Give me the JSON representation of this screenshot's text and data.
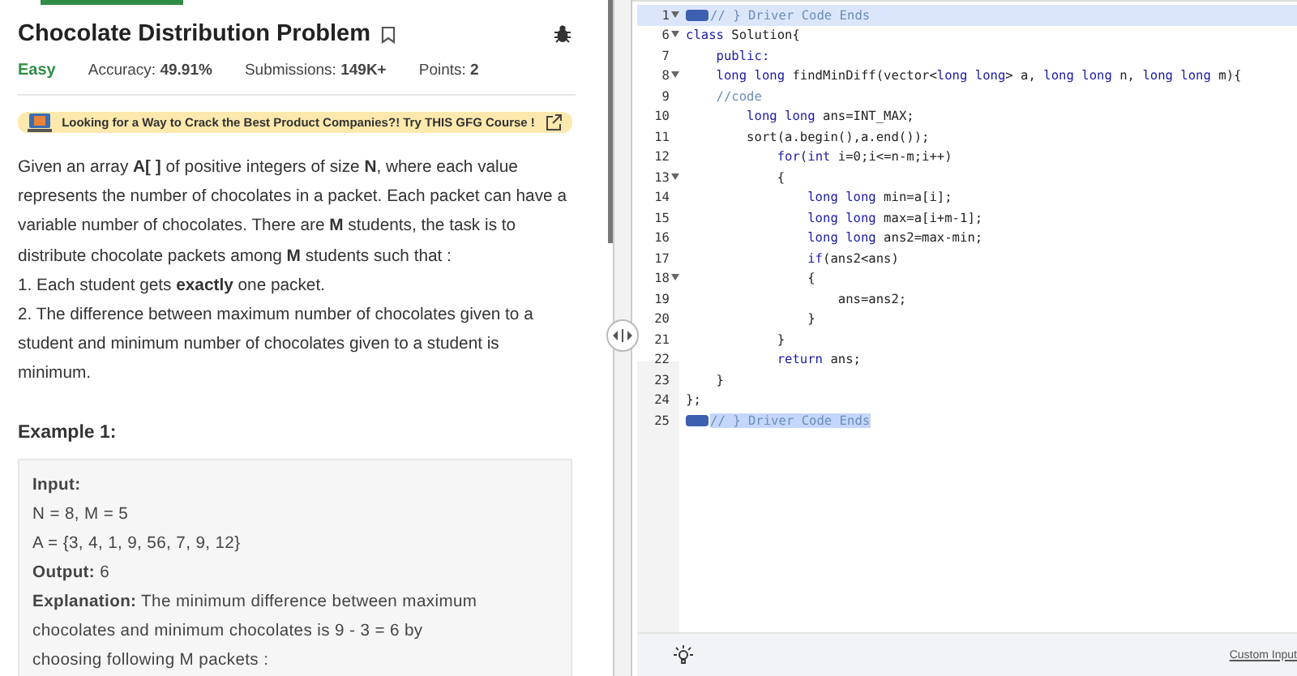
{
  "top_tab": {
    "selected": true
  },
  "problem": {
    "title": "Chocolate Distribution Problem",
    "difficulty": "Easy",
    "stats": [
      {
        "label": "Accuracy:",
        "value": "49.91%"
      },
      {
        "label": "Submissions:",
        "value": "149K+"
      },
      {
        "label": "Points:",
        "value": "2"
      }
    ],
    "banner": "Looking for a Way to Crack the Best Product Companies?! Try THIS GFG Course !",
    "description": [
      "Given an array **A[ ]** of positive integers of size **N**, where each value represents the number of chocolates in a packet. Each packet can have a variable number of chocolates. There are **M** students, the task is to distribute chocolate packets among **M** students such that :",
      "1. Each student gets **exactly** one packet.",
      "2. The difference between maximum number of chocolates given to a student and minimum number of chocolates given to a student is minimum."
    ],
    "example_title": "Example 1:",
    "example_lines": [
      {
        "kind": "label",
        "text": "Input:"
      },
      {
        "kind": "text",
        "text": "N = 8, M = 5"
      },
      {
        "kind": "text",
        "text": "A = {3, 4, 1, 9, 56, 7, 9, 12}"
      },
      {
        "kind": "text",
        "text": "**Output:** 6"
      },
      {
        "kind": "text",
        "text": "**Explanation:** The minimum difference between maximum chocolates and minimum chocolates is 9 - 3 = 6 by choosing following M packets :"
      }
    ]
  },
  "editor": {
    "lines": [
      {
        "number": "1",
        "foldable": true,
        "highlighted": true,
        "folded": true,
        "tokens": [
          {
            "kind": "comment",
            "text": "// } Driver Code Ends"
          }
        ]
      },
      {
        "number": "6",
        "foldable": true,
        "highlighted": false,
        "folded": false,
        "tokens": [
          {
            "kind": "keyword",
            "text": "class"
          },
          {
            "kind": "plain",
            "text": " Solution{"
          }
        ]
      },
      {
        "number": "7",
        "foldable": false,
        "highlighted": false,
        "folded": false,
        "tokens": [
          {
            "kind": "keyword",
            "text": "    public:"
          }
        ]
      },
      {
        "number": "8",
        "foldable": true,
        "highlighted": false,
        "folded": false,
        "tokens": [
          {
            "kind": "keyword",
            "text": "    long long"
          },
          {
            "kind": "plain",
            "text": " findMinDiff(vector<"
          },
          {
            "kind": "keyword",
            "text": "long long"
          },
          {
            "kind": "plain",
            "text": "> a, "
          },
          {
            "kind": "keyword",
            "text": "long long"
          },
          {
            "kind": "plain",
            "text": " n, "
          },
          {
            "kind": "keyword",
            "text": "long long"
          },
          {
            "kind": "plain",
            "text": " m){"
          }
        ]
      },
      {
        "number": "9",
        "foldable": false,
        "highlighted": false,
        "folded": false,
        "tokens": [
          {
            "kind": "comment",
            "text": "    //code"
          }
        ]
      },
      {
        "number": "10",
        "foldable": false,
        "highlighted": false,
        "folded": false,
        "tokens": [
          {
            "kind": "keyword",
            "text": "        long long"
          },
          {
            "kind": "plain",
            "text": " ans=INT_MAX;"
          }
        ]
      },
      {
        "number": "11",
        "foldable": false,
        "highlighted": false,
        "folded": false,
        "tokens": [
          {
            "kind": "plain",
            "text": "        sort(a.begin(),a.end());"
          }
        ]
      },
      {
        "number": "12",
        "foldable": false,
        "highlighted": false,
        "folded": false,
        "tokens": [
          {
            "kind": "keyword",
            "text": "            for"
          },
          {
            "kind": "plain",
            "text": "("
          },
          {
            "kind": "keyword",
            "text": "int"
          },
          {
            "kind": "plain",
            "text": " i=0;i<=n-m;i++)"
          }
        ]
      },
      {
        "number": "13",
        "foldable": true,
        "highlighted": false,
        "folded": false,
        "tokens": [
          {
            "kind": "plain",
            "text": "            {"
          }
        ]
      },
      {
        "number": "14",
        "foldable": false,
        "highlighted": false,
        "folded": false,
        "tokens": [
          {
            "kind": "keyword",
            "text": "                long long"
          },
          {
            "kind": "plain",
            "text": " min=a[i];"
          }
        ]
      },
      {
        "number": "15",
        "foldable": false,
        "highlighted": false,
        "folded": false,
        "tokens": [
          {
            "kind": "keyword",
            "text": "                long long"
          },
          {
            "kind": "plain",
            "text": " max=a[i+m-1];"
          }
        ]
      },
      {
        "number": "16",
        "foldable": false,
        "highlighted": false,
        "folded": false,
        "tokens": [
          {
            "kind": "keyword",
            "text": "                long long"
          },
          {
            "kind": "plain",
            "text": " ans2=max-min;"
          }
        ]
      },
      {
        "number": "17",
        "foldable": false,
        "highlighted": false,
        "folded": false,
        "tokens": [
          {
            "kind": "keyword",
            "text": "                if"
          },
          {
            "kind": "plain",
            "text": "(ans2<ans)"
          }
        ]
      },
      {
        "number": "18",
        "foldable": true,
        "highlighted": false,
        "folded": false,
        "tokens": [
          {
            "kind": "plain",
            "text": "                {"
          }
        ]
      },
      {
        "number": "19",
        "foldable": false,
        "highlighted": false,
        "folded": false,
        "tokens": [
          {
            "kind": "plain",
            "text": "                    ans=ans2;"
          }
        ]
      },
      {
        "number": "20",
        "foldable": false,
        "highlighted": false,
        "folded": false,
        "tokens": [
          {
            "kind": "plain",
            "text": "                }"
          }
        ]
      },
      {
        "number": "21",
        "foldable": false,
        "highlighted": false,
        "folded": false,
        "tokens": [
          {
            "kind": "plain",
            "text": "            }"
          }
        ]
      },
      {
        "number": "22",
        "foldable": false,
        "highlighted": false,
        "folded": false,
        "tokens": [
          {
            "kind": "keyword",
            "text": "            return"
          },
          {
            "kind": "plain",
            "text": " ans;"
          }
        ]
      },
      {
        "number": "23",
        "foldable": false,
        "highlighted": false,
        "folded": false,
        "tokens": [
          {
            "kind": "plain",
            "text": "    }"
          }
        ]
      },
      {
        "number": "24",
        "foldable": false,
        "highlighted": false,
        "folded": false,
        "tokens": [
          {
            "kind": "plain",
            "text": "};"
          }
        ]
      },
      {
        "number": "25",
        "foldable": false,
        "highlighted": false,
        "folded": true,
        "tokens": [
          {
            "kind": "comment",
            "text": "// } Driver Code Ends"
          }
        ]
      }
    ],
    "custom_input_link": "Custom Input"
  }
}
